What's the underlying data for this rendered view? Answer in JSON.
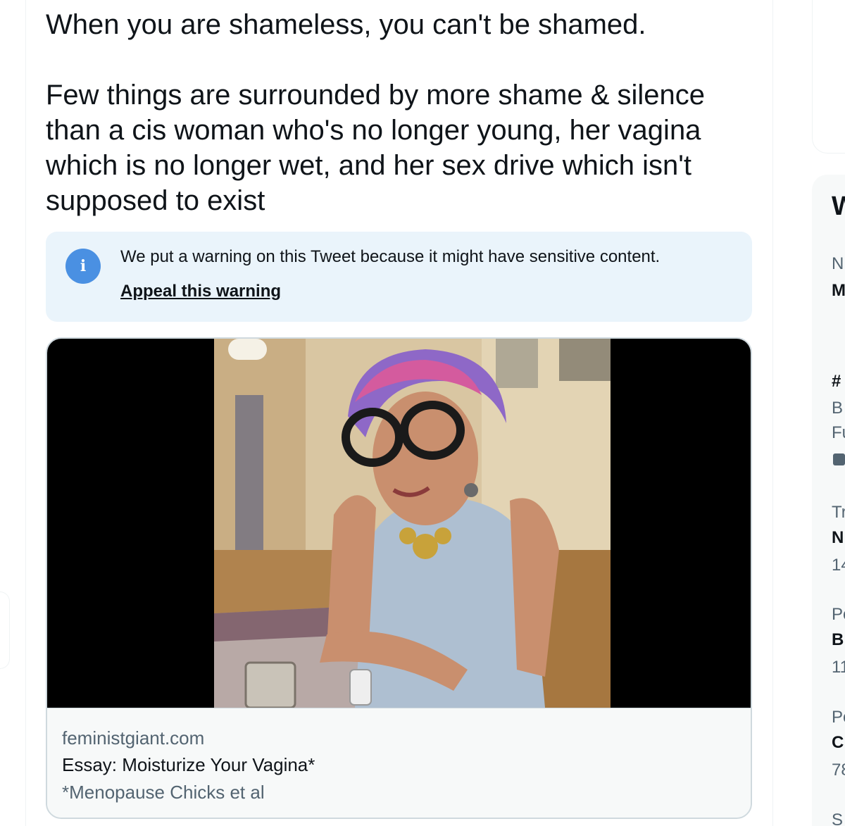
{
  "tweet": {
    "text": "When you are shameless, you can't be shamed.\n\nFew things are surrounded by more shame & silence\nthan a cis woman who's no longer young, her vagina\nwhich is no longer wet, and her sex drive which isn't\nsupposed to exist"
  },
  "warning": {
    "icon": "info-icon",
    "text": "We put a warning on this Tweet because it might have sensitive content.",
    "link_label": "Appeal this warning"
  },
  "link_card": {
    "domain": "feministgiant.com",
    "title": "Essay: Moisturize Your Vagina*",
    "description": "*Menopause Chicks et al"
  },
  "sidebar": {
    "heading_fragment": "W",
    "items": [
      {
        "meta": "N",
        "title": "M"
      },
      {
        "meta": "B",
        "title": "#",
        "extra": "Fu"
      },
      {
        "meta": "Tr",
        "title": "N",
        "count": "14"
      },
      {
        "meta": "Po",
        "title": "B",
        "count": "11"
      },
      {
        "meta": "Po",
        "title": "C",
        "count": "78"
      }
    ],
    "bottom_fragment": "S"
  },
  "colors": {
    "accent": "#1d9bf0",
    "warning_bg": "#eaf4fb",
    "info_icon": "#4a90e2",
    "muted_text": "#536471"
  }
}
